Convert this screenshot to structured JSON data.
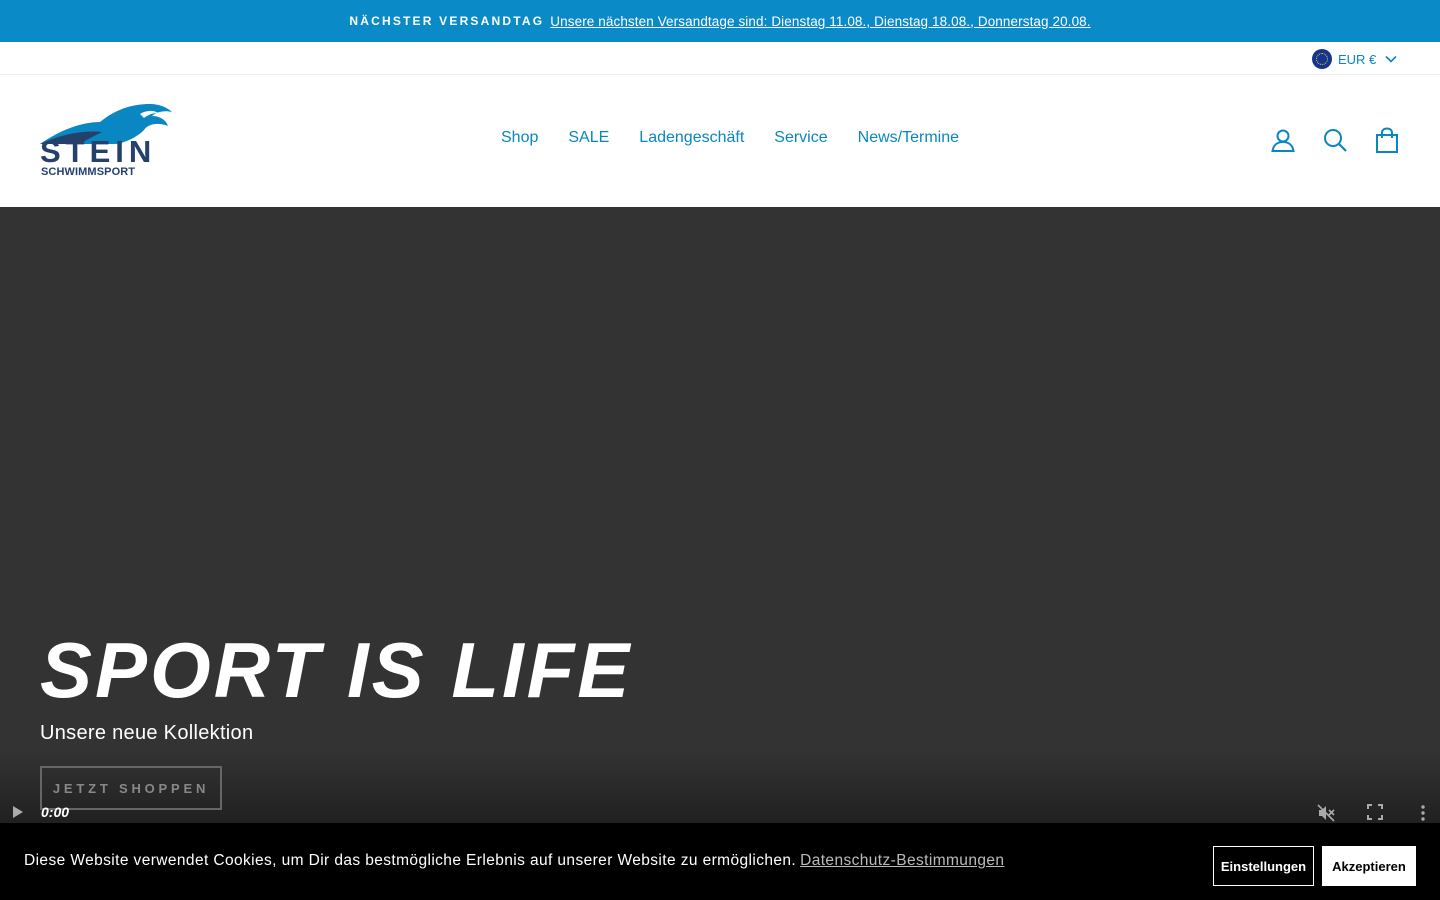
{
  "announcement": {
    "label": "NÄCHSTER VERSANDTAG",
    "link_text": "Unsere nächsten Versandtage sind: Dienstag 11.08., Dienstag 18.08., Donnerstag 20.08."
  },
  "currency": {
    "label": "EUR €",
    "flag_icon": "eu-flag-icon"
  },
  "logo": {
    "word": "STEIN",
    "sub": "SCHWIMMSPORT"
  },
  "nav": {
    "items": [
      {
        "label": "Shop"
      },
      {
        "label": "SALE"
      },
      {
        "label": "Ladengeschäft"
      },
      {
        "label": "Service"
      },
      {
        "label": "News/Termine"
      }
    ]
  },
  "header_icons": [
    "account-icon",
    "search-icon",
    "cart-icon"
  ],
  "hero": {
    "title": "SPORT IS LIFE",
    "subtitle": "Unsere neue Kollektion",
    "button_label": "JETZT SHOPPEN"
  },
  "video": {
    "time": "0:00"
  },
  "cookie": {
    "message": "Diese Website verwendet Cookies, um Dir das bestmögliche Erlebnis auf unserer Website zu ermöglichen.",
    "link_text": "Datenschutz-Bestimmungen",
    "settings_label": "Einstellungen",
    "accept_label": "Akzeptieren"
  },
  "colors": {
    "brand_blue": "#0a8ac6",
    "logo_navy": "#24416b",
    "hero_bg": "#333333",
    "cookie_bg": "#000000"
  }
}
